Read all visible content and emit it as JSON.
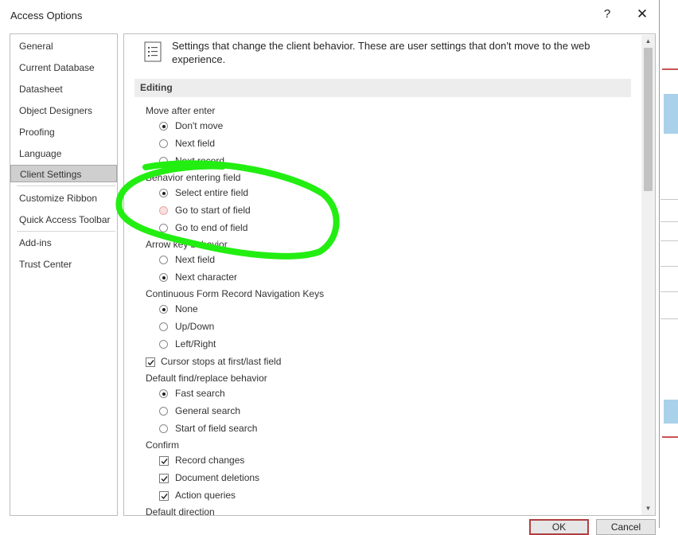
{
  "window": {
    "title": "Access Options",
    "help_glyph": "?",
    "close_glyph": "✕"
  },
  "nav": {
    "selected": "Client Settings",
    "items": [
      {
        "label": "General"
      },
      {
        "label": "Current Database"
      },
      {
        "label": "Datasheet"
      },
      {
        "label": "Object Designers"
      },
      {
        "label": "Proofing"
      },
      {
        "label": "Language"
      },
      {
        "label": "Client Settings"
      },
      {
        "label": "Customize Ribbon"
      },
      {
        "label": "Quick Access Toolbar"
      },
      {
        "label": "Add-ins"
      },
      {
        "label": "Trust Center"
      }
    ]
  },
  "content": {
    "header_text": "Settings that change the client behavior. These are user settings that don't move to the web experience.",
    "section_title": "Editing",
    "groups": [
      {
        "label": "Move after enter",
        "options": [
          "Don't move",
          "Next field",
          "Next record"
        ],
        "selected": 0
      },
      {
        "label": "Behavior entering field",
        "options": [
          "Select entire field",
          "Go to start of field",
          "Go to end of field"
        ],
        "selected": 0
      },
      {
        "label": "Arrow key behavior",
        "options": [
          "Next field",
          "Next character"
        ],
        "selected": 1
      },
      {
        "label": "Continuous Form Record Navigation Keys",
        "options": [
          "None",
          "Up/Down",
          "Left/Right"
        ],
        "selected": 0
      }
    ],
    "cursor_stops": {
      "label": "Cursor stops at first/last field",
      "checked": true
    },
    "find_replace": {
      "label": "Default find/replace behavior",
      "options": [
        "Fast search",
        "General search",
        "Start of field search"
      ],
      "selected": 0
    },
    "confirm": {
      "label": "Confirm",
      "options": [
        {
          "label": "Record changes",
          "checked": true
        },
        {
          "label": "Document deletions",
          "checked": true
        },
        {
          "label": "Action queries",
          "checked": true
        }
      ]
    },
    "default_direction_label": "Default direction"
  },
  "buttons": {
    "ok": "OK",
    "cancel": "Cancel"
  },
  "colors": {
    "annotation": "#22ee11",
    "selected_nav": "#cfcfcf"
  }
}
